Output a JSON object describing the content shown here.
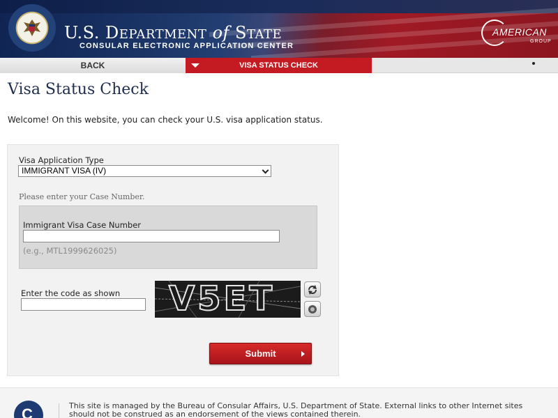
{
  "header": {
    "title_prefix": "U.S. D",
    "title_dept": "EPARTMENT",
    "title_of": "of",
    "title_state": "S",
    "title_state_rest": "TATE",
    "subtitle": "CONSULAR ELECTRONIC APPLICATION CENTER",
    "agency_logo_word": "AMERICAN",
    "agency_logo_group": "GROUP"
  },
  "nav": {
    "back_label": "BACK",
    "active_label": "VISA STATUS CHECK"
  },
  "page": {
    "title": "Visa Status Check",
    "welcome": "Welcome! On this website, you can check your U.S. visa application status."
  },
  "form": {
    "visa_type_label": "Visa Application Type",
    "visa_type_value": "IMMIGRANT VISA (IV)",
    "case_prompt": "Please enter your Case Number.",
    "case_label": "Immigrant Visa Case Number",
    "case_value": "",
    "case_example": "(e.g., MTL1999626025)",
    "code_label": "Enter the code as shown",
    "code_value": "",
    "captcha_text": "V5ET",
    "submit_label": "Submit"
  },
  "footer": {
    "text": "This site is managed by the Bureau of Consular Affairs, U.S. Department of State. External links to other Internet sites should not be construed as an endorsement of the views contained therein.",
    "logo_letter": "C"
  },
  "colors": {
    "accent_red": "#c41a22",
    "navy": "#1f2d4d",
    "panel_gray": "#f2f2f2"
  },
  "icons": {
    "seal": "us-state-department-seal-icon",
    "refresh": "refresh-icon",
    "audio": "audio-icon",
    "submit_arrow": "chevron-right-icon",
    "nav_caret": "caret-down-icon"
  }
}
